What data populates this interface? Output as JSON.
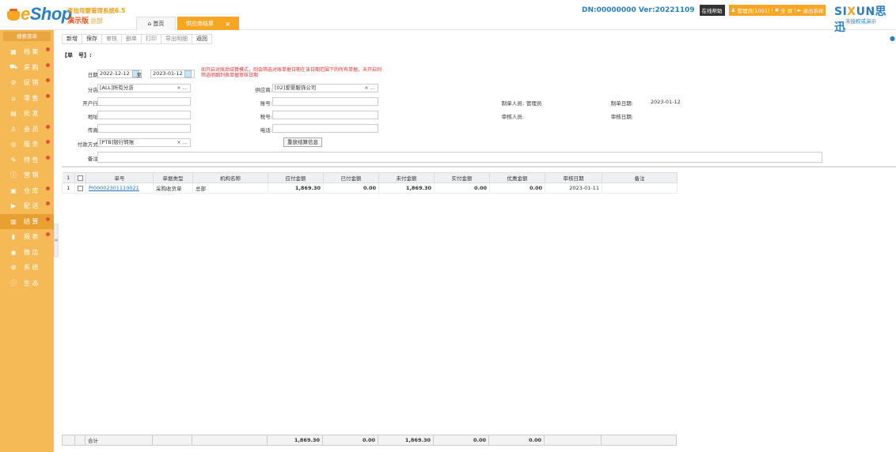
{
  "header": {
    "logo_text": "eShop",
    "system_name": "考拉母婴管理系统6.5",
    "demo_label": "演示版",
    "branch": "总部",
    "tabs": [
      {
        "label": "首页"
      },
      {
        "label": "供应商结算"
      }
    ],
    "dn_version": "DN:00000000 Ver:20221109",
    "online_help": "在线帮助",
    "admin": "管理员[1001]",
    "fullscreen": "全 屏",
    "logout": "退出系统",
    "brand": "SIXUN思迅",
    "auth_note": "未授权或演示"
  },
  "sidebar": {
    "search_label": "搜索菜单",
    "items": [
      {
        "label": "档 案",
        "icon": "archive-icon",
        "dot": true
      },
      {
        "label": "采 购",
        "icon": "cart-icon",
        "dot": true
      },
      {
        "label": "促 销",
        "icon": "tag-icon",
        "dot": true
      },
      {
        "label": "零 售",
        "icon": "bag-icon",
        "dot": true
      },
      {
        "label": "批 发",
        "icon": "chart-icon",
        "dot": false
      },
      {
        "label": "会 员",
        "icon": "user-icon",
        "dot": true
      },
      {
        "label": "服 务",
        "icon": "service-icon",
        "dot": true
      },
      {
        "label": "特 性",
        "icon": "wand-icon",
        "dot": true
      },
      {
        "label": "营 销",
        "icon": "info-icon",
        "dot": false
      },
      {
        "label": "仓 库",
        "icon": "warehouse-icon",
        "dot": true
      },
      {
        "label": "配 送",
        "icon": "truck-icon",
        "dot": true
      },
      {
        "label": "结 算",
        "icon": "settle-icon",
        "dot": true
      },
      {
        "label": "报 表",
        "icon": "bar-chart-icon",
        "dot": true
      },
      {
        "label": "微 店",
        "icon": "shop-icon",
        "dot": false
      },
      {
        "label": "系 统",
        "icon": "gear-icon",
        "dot": false
      },
      {
        "label": "生 态",
        "icon": "eco-icon",
        "dot": false
      }
    ]
  },
  "toolbar": {
    "buttons": [
      "新增",
      "保存",
      "审核",
      "删单",
      "打印",
      "导出明细",
      "返回"
    ]
  },
  "form": {
    "doc_no_label": "【单　号】:",
    "date_label": "日期:",
    "date_from": "2022-12-12",
    "to_label": "至",
    "date_to": "2023-01-12",
    "note": "如开启对账后结算模式，则会筛选对账单据日期在该日期范围下的所有单据，未开启则筛选明细列表单据审核日期",
    "branch_label": "分店:",
    "branch_value": "[ALL]所有分店",
    "supplier_label": "供应商:",
    "supplier_value": "[02]爱婴服饰公司",
    "bank_label": "开户行:",
    "account_label": "账号:",
    "maker_label": "制单人员:",
    "maker_value": "管理员",
    "make_date_label": "制单日期:",
    "make_date_value": "2023-01-12",
    "address_label": "地址:",
    "tax_label": "税号:",
    "auditor_label": "审核人员:",
    "audit_date_label": "审核日期:",
    "fax_label": "传真:",
    "phone_label": "电话:",
    "pay_method_label": "付款方式:",
    "pay_method_value": "[PTB]银行转账",
    "fetch_button": "重获结算信息",
    "remark_label": "备注:"
  },
  "grid": {
    "header_count": "1",
    "columns": [
      "单号",
      "单据类型",
      "机构名称",
      "应付金额",
      "已付金额",
      "未付金额",
      "实付金额",
      "优惠金额",
      "审核日期",
      "备注"
    ],
    "rows": [
      {
        "index": "1",
        "doc_no": "PI00002301110021",
        "type": "采购收货单",
        "org": "总部",
        "payable": "1,869.30",
        "paid": "0.00",
        "unpaid": "1,869.30",
        "actual": "0.00",
        "discount": "0.00",
        "audit_date": "2023-01-11",
        "remark": ""
      }
    ],
    "total": {
      "label": "合计",
      "payable": "1,869.30",
      "paid": "0.00",
      "unpaid": "1,869.30",
      "actual": "0.00",
      "discount": "0.00"
    }
  }
}
